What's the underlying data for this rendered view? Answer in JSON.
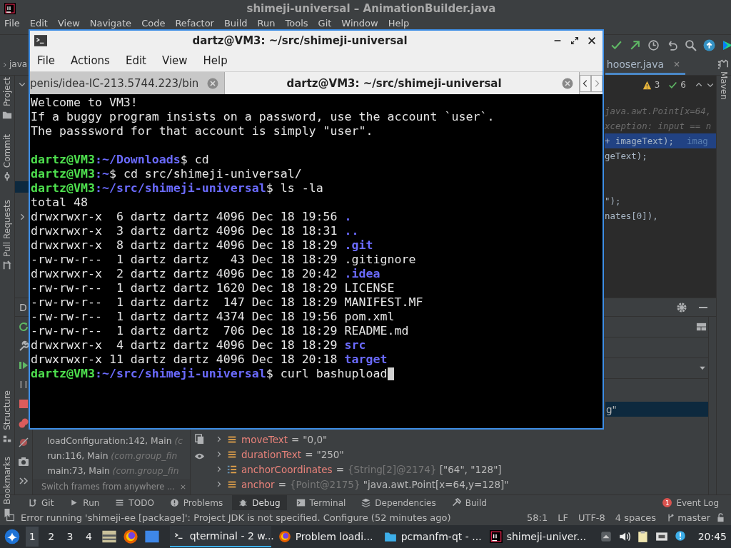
{
  "ide": {
    "title": "shimeji-universal – AnimationBuilder.java",
    "menu": [
      "File",
      "Edit",
      "View",
      "Navigate",
      "Code",
      "Refactor",
      "Build",
      "Run",
      "Tools",
      "Git",
      "Window",
      "Help"
    ],
    "breadcrumb": "java",
    "editor_tab": "hooser.java",
    "inspections": {
      "warnings": "3",
      "passed": "6"
    },
    "left_tools": [
      {
        "label": "Project",
        "kind": "project"
      },
      {
        "label": "Commit",
        "kind": "commit"
      },
      {
        "label": "Pull Requests",
        "kind": "pull"
      },
      {
        "label": "Structure",
        "kind": "structure"
      },
      {
        "label": "Bookmarks",
        "kind": "bookmarks"
      }
    ],
    "right_tools": [
      "Maven"
    ],
    "code_lines": [
      {
        "kind": "hint",
        "text": "java.awt.Point[x=64,"
      },
      {
        "kind": "hint",
        "text": "xception: input == n"
      },
      {
        "kind": "current",
        "text": "+ imageText);",
        "hint": "imag"
      },
      {
        "kind": "code",
        "text": "geText);"
      },
      {
        "kind": "blank"
      },
      {
        "kind": "blank"
      },
      {
        "kind": "code",
        "text": "\");"
      },
      {
        "kind": "code",
        "text": "nates[0]),"
      }
    ],
    "debug": {
      "tab": "D",
      "frames": [
        {
          "method": "loadConfiguration:142, Main",
          "detail": "(c"
        },
        {
          "method": "run:116, Main",
          "detail": "(com.group_fin"
        },
        {
          "method": "main:73, Main",
          "detail": "(com.group_fin"
        }
      ],
      "frames_hint": "Switch frames from anywhere ...",
      "selected_value": "g\"",
      "variables": [
        {
          "kind": "field",
          "name": "moveText",
          "separator": "=",
          "value": "\"0,0\""
        },
        {
          "kind": "field",
          "name": "durationText",
          "separator": "=",
          "value": "\"250\""
        },
        {
          "kind": "array",
          "name": "anchorCoordinates",
          "separator": "=",
          "ref": "{String[2]@2174}",
          "value": "[\"64\", \"128\"]"
        },
        {
          "kind": "field",
          "name": "anchor",
          "separator": "=",
          "ref": "{Point@2175}",
          "value": "\"java.awt.Point[x=64,y=128]\""
        }
      ]
    },
    "tool_tabs": [
      {
        "kind": "git",
        "label": "Git",
        "selected": false
      },
      {
        "kind": "run",
        "label": "Run",
        "selected": false
      },
      {
        "kind": "todo",
        "label": "TODO",
        "selected": false
      },
      {
        "kind": "problems",
        "label": "Problems",
        "selected": false
      },
      {
        "kind": "debug",
        "label": "Debug",
        "selected": true
      },
      {
        "kind": "terminal",
        "label": "Terminal",
        "selected": false
      },
      {
        "kind": "dependencies",
        "label": "Dependencies",
        "selected": false
      },
      {
        "kind": "build",
        "label": "Build",
        "selected": false
      }
    ],
    "event_log": {
      "badge": "1",
      "label": "Event Log"
    },
    "status": {
      "message": "Error running 'shimeji-ee [package]': Project JDK is not specified. Configure (52 minutes ago)",
      "items": [
        "58:1",
        "LF",
        "UTF-8",
        "4 spaces"
      ],
      "branch": "master"
    }
  },
  "terminal": {
    "title": "dartz@VM3: ~/src/shimeji-universal",
    "menu": [
      "File",
      "Actions",
      "Edit",
      "View",
      "Help"
    ],
    "tabs": [
      {
        "label": "penis/idea-IC-213.5744.223/bin",
        "selected": false
      },
      {
        "label": "dartz@VM3: ~/src/shimeji-universal",
        "selected": true
      }
    ],
    "lines": [
      {
        "kind": "output",
        "text": "Welcome to VM3!"
      },
      {
        "kind": "output",
        "text": "If a buggy program insists on a password, use the account `user`."
      },
      {
        "kind": "output",
        "text": "The passsword for that account is simply \"user\"."
      },
      {
        "kind": "blank"
      },
      {
        "kind": "prompt",
        "user": "dartz@VM3",
        "path": ":~/Downloads",
        "command": "$ cd",
        "cursor": false
      },
      {
        "kind": "prompt",
        "user": "dartz@VM3",
        "path": ":~",
        "command": "$ cd src/shimeji-universal/",
        "cursor": false
      },
      {
        "kind": "prompt",
        "user": "dartz@VM3",
        "path": ":~/src/shimeji-universal",
        "command": "$ ls -la",
        "cursor": false
      },
      {
        "kind": "output",
        "text": "total 48"
      },
      {
        "kind": "listing",
        "info": "drwxrwxr-x  6 dartz dartz 4096 Dec 18 19:56 ",
        "name": ".",
        "dir": true
      },
      {
        "kind": "listing",
        "info": "drwxrwxr-x  3 dartz dartz 4096 Dec 18 18:31 ",
        "name": "..",
        "dir": true
      },
      {
        "kind": "listing",
        "info": "drwxrwxr-x  8 dartz dartz 4096 Dec 18 18:29 ",
        "name": ".git",
        "dir": true
      },
      {
        "kind": "listing",
        "info": "-rw-rw-r--  1 dartz dartz   43 Dec 18 18:29 ",
        "name": ".gitignore",
        "dir": false
      },
      {
        "kind": "listing",
        "info": "drwxrwxr-x  2 dartz dartz 4096 Dec 18 20:42 ",
        "name": ".idea",
        "dir": true
      },
      {
        "kind": "listing",
        "info": "-rw-rw-r--  1 dartz dartz 1620 Dec 18 18:29 ",
        "name": "LICENSE",
        "dir": false
      },
      {
        "kind": "listing",
        "info": "-rw-rw-r--  1 dartz dartz  147 Dec 18 18:29 ",
        "name": "MANIFEST.MF",
        "dir": false
      },
      {
        "kind": "listing",
        "info": "-rw-rw-r--  1 dartz dartz 4374 Dec 18 19:56 ",
        "name": "pom.xml",
        "dir": false
      },
      {
        "kind": "listing",
        "info": "-rw-rw-r--  1 dartz dartz  706 Dec 18 18:29 ",
        "name": "README.md",
        "dir": false
      },
      {
        "kind": "listing",
        "info": "drwxrwxr-x  4 dartz dartz 4096 Dec 18 18:29 ",
        "name": "src",
        "dir": true
      },
      {
        "kind": "listing",
        "info": "drwxrwxr-x 11 dartz dartz 4096 Dec 18 20:18 ",
        "name": "target",
        "dir": true
      },
      {
        "kind": "prompt",
        "user": "dartz@VM3",
        "path": ":~/src/shimeji-universal",
        "command": "$ curl bashupload",
        "cursor": true
      }
    ]
  },
  "taskbar": {
    "workspaces": [
      {
        "label": "1",
        "selected": true
      },
      {
        "label": "2",
        "selected": false
      },
      {
        "label": "3",
        "selected": false
      },
      {
        "label": "4",
        "selected": false
      }
    ],
    "tasks": [
      {
        "kind": "terminal",
        "label": "qterminal - 2 w...",
        "selected": true
      },
      {
        "kind": "browser",
        "label": "Problem loadi...",
        "selected": false
      },
      {
        "kind": "folder",
        "label": "pcmanfm-qt - ...",
        "selected": false
      },
      {
        "kind": "ide",
        "label": "shimeji-univer...",
        "selected": false
      }
    ],
    "clock": "20:45"
  }
}
